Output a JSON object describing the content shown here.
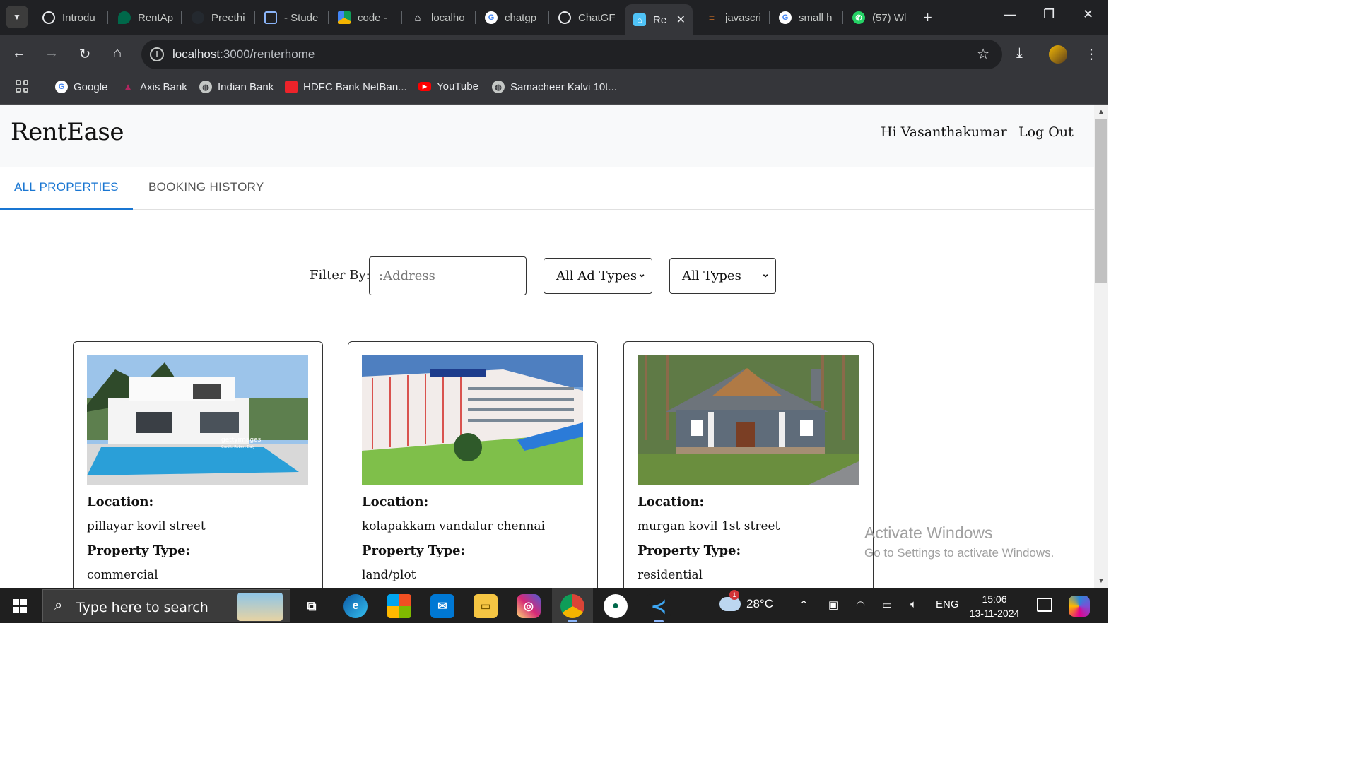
{
  "browser": {
    "tabs": [
      {
        "title": "Introdu",
        "icon": "openai-icon"
      },
      {
        "title": "RentAp",
        "icon": "mongodb-icon"
      },
      {
        "title": "Preethi",
        "icon": "github-icon"
      },
      {
        "title": "- Stude",
        "icon": "monitor-icon"
      },
      {
        "title": "code -",
        "icon": "google-drive-icon"
      },
      {
        "title": "localho",
        "icon": "home-icon"
      },
      {
        "title": "chatgp",
        "icon": "google-icon"
      },
      {
        "title": "ChatGF",
        "icon": "openai-icon"
      },
      {
        "title": "Re",
        "icon": "home-icon",
        "active": true
      },
      {
        "title": "javascri",
        "icon": "stackoverflow-icon"
      },
      {
        "title": "small h",
        "icon": "google-icon"
      },
      {
        "title": "(57) Wl",
        "icon": "whatsapp-icon"
      }
    ],
    "url_host": "localhost",
    "url_path": ":3000/renterhome",
    "bookmarks": [
      {
        "label": "Google",
        "icon": "google-icon"
      },
      {
        "label": "Axis Bank",
        "icon": "axis-bank-icon"
      },
      {
        "label": "Indian Bank",
        "icon": "globe-icon"
      },
      {
        "label": "HDFC Bank NetBan...",
        "icon": "hdfc-icon"
      },
      {
        "label": "YouTube",
        "icon": "youtube-icon"
      },
      {
        "label": "Samacheer Kalvi 10t...",
        "icon": "globe-icon"
      }
    ]
  },
  "app": {
    "brand": "RentEase",
    "greeting": "Hi Vasanthakumar",
    "logout": "Log Out",
    "tabs": [
      "ALL PROPERTIES",
      "BOOKING HISTORY"
    ],
    "active_tab": "ALL PROPERTIES"
  },
  "filter": {
    "label": "Filter By:",
    "address_placeholder": ":Address",
    "ad_type": "All Ad Types",
    "type": "All Types"
  },
  "properties": [
    {
      "location_label": "Location:",
      "location": "pillayar kovil street",
      "type_label": "Property Type:",
      "type": "commercial",
      "image": "modern-villa-with-pool"
    },
    {
      "location_label": "Location:",
      "location": "kolapakkam vandalur chennai",
      "type_label": "Property Type:",
      "type": "land/plot",
      "image": "college-building"
    },
    {
      "location_label": "Location:",
      "location": "murgan kovil 1st street",
      "type_label": "Property Type:",
      "type": "residential",
      "image": "grey-cottage-house"
    }
  ],
  "photo_text": {
    "getty": "gettyimages",
    "credit": "Credit: Robert Daly"
  },
  "watermark": {
    "line1": "Activate Windows",
    "line2": "Go to Settings to activate Windows."
  },
  "taskbar": {
    "search_placeholder": "Type here to search",
    "temperature": "28°C",
    "weather_badge": "1",
    "language": "ENG",
    "time": "15:06",
    "date": "13-11-2024"
  }
}
